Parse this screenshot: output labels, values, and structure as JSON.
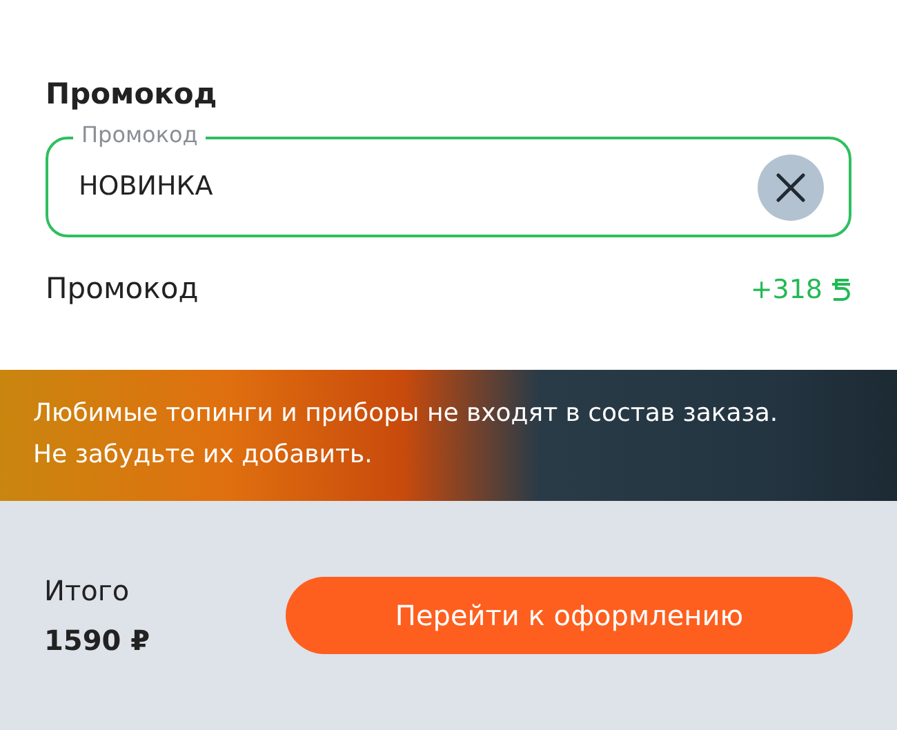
{
  "promo_section": {
    "title": "Промокод",
    "field": {
      "label": "Промокод",
      "value": "НОВИНКА"
    },
    "discount": {
      "label": "Промокод",
      "amount": "+318"
    }
  },
  "banner": {
    "text": "Любимые топинги и приборы не входят в состав заказа. Не забудьте их добавить."
  },
  "footer": {
    "total_label": "Итого",
    "total_value": "1590 ₽",
    "checkout_button": "Перейти к оформлению"
  }
}
